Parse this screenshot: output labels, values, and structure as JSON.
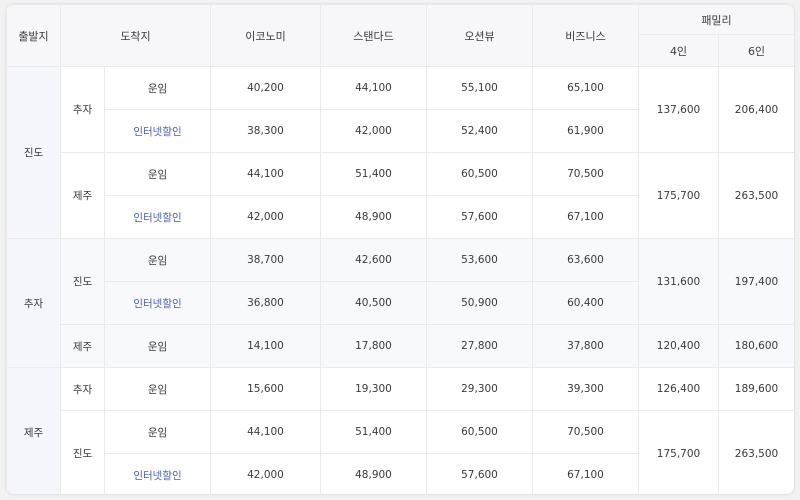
{
  "headers": {
    "origin": "출발지",
    "destination": "도착지",
    "economy": "이코노미",
    "standard": "스탠다드",
    "oceanview": "오션뷰",
    "business": "비즈니스",
    "family": "패밀리",
    "family4": "4인",
    "family6": "6인"
  },
  "groups": [
    {
      "origin": "진도",
      "dests": [
        {
          "name": "추자",
          "family4": "137,600",
          "family6": "206,400",
          "rows": [
            {
              "type": "운임",
              "economy": "40,200",
              "standard": "44,100",
              "oceanview": "55,100",
              "business": "65,100"
            },
            {
              "type": "인터넷할인",
              "economy": "38,300",
              "standard": "42,000",
              "oceanview": "52,400",
              "business": "61,900"
            }
          ]
        },
        {
          "name": "제주",
          "family4": "175,700",
          "family6": "263,500",
          "rows": [
            {
              "type": "운임",
              "economy": "44,100",
              "standard": "51,400",
              "oceanview": "60,500",
              "business": "70,500"
            },
            {
              "type": "인터넷할인",
              "economy": "42,000",
              "standard": "48,900",
              "oceanview": "57,600",
              "business": "67,100"
            }
          ]
        }
      ]
    },
    {
      "origin": "추자",
      "dests": [
        {
          "name": "진도",
          "family4": "131,600",
          "family6": "197,400",
          "rows": [
            {
              "type": "운임",
              "economy": "38,700",
              "standard": "42,600",
              "oceanview": "53,600",
              "business": "63,600"
            },
            {
              "type": "인터넷할인",
              "economy": "36,800",
              "standard": "40,500",
              "oceanview": "50,900",
              "business": "60,400"
            }
          ]
        },
        {
          "name": "제주",
          "family4": "120,400",
          "family6": "180,600",
          "rows": [
            {
              "type": "운임",
              "economy": "14,100",
              "standard": "17,800",
              "oceanview": "27,800",
              "business": "37,800"
            }
          ]
        }
      ]
    },
    {
      "origin": "제주",
      "dests": [
        {
          "name": "추자",
          "family4": "126,400",
          "family6": "189,600",
          "rows": [
            {
              "type": "운임",
              "economy": "15,600",
              "standard": "19,300",
              "oceanview": "29,300",
              "business": "39,300"
            }
          ]
        },
        {
          "name": "진도",
          "family4": "175,700",
          "family6": "263,500",
          "rows": [
            {
              "type": "운임",
              "economy": "44,100",
              "standard": "51,400",
              "oceanview": "60,500",
              "business": "70,500"
            },
            {
              "type": "인터넷할인",
              "economy": "42,000",
              "standard": "48,900",
              "oceanview": "57,600",
              "business": "67,100"
            }
          ]
        }
      ]
    }
  ]
}
